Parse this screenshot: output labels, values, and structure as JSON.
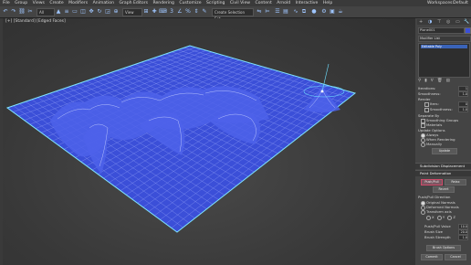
{
  "menu": {
    "items": [
      "File",
      "Group",
      "Views",
      "Create",
      "Modifiers",
      "Animation",
      "Graph Editors",
      "Rendering",
      "Customize",
      "Scripting",
      "Civil View",
      "Content",
      "Arnold",
      "Interactive",
      "Help"
    ],
    "workspaces_label": "Workspaces:",
    "workspace_value": "Default"
  },
  "toolbar": {
    "filter_value": "All",
    "create_selection_placeholder": "Create Selection Set"
  },
  "viewport": {
    "label": "[+] [Standard] [Edged Faces]",
    "mesh_color": "#3b4fd8",
    "wire_color": "#a9b6ff",
    "border_color": "#7fe6ff"
  },
  "panel": {
    "object_name": "Plane001",
    "modifier_list_label": "Modifier List",
    "stack_item": "Editable Poly",
    "smoothing": {
      "iterations_label": "Iterations:",
      "iterations_value": "1",
      "smoothness_label": "Smoothness:",
      "smoothness_value": "1.0",
      "render_label": "Render",
      "render_iters_label": "Iters:",
      "render_iters_value": "0",
      "smoothness2_label": "Smoothness:",
      "smoothness2_value": "1.0",
      "separate_by_label": "Separate By",
      "smoothing_groups_label": "Smoothing Groups",
      "materials_label": "Materials",
      "update_options_label": "Update Options",
      "always_label": "Always",
      "when_rendering_label": "When Rendering",
      "manually_label": "Manually",
      "update_button": "Update"
    },
    "subdivision_displacement_label": "Subdivision Displacement",
    "paint_deformation_label": "Paint Deformation",
    "push_pull_button": "Push/Pull",
    "relax_button": "Relax",
    "revert_button": "Revert",
    "push_pull_direction_label": "Push/Pull Direction",
    "original_normals_label": "Original Normals",
    "deformed_normals_label": "Deformed Normals",
    "transform_axis_label": "Transform axis",
    "axis_x": "X",
    "axis_y": "Y",
    "axis_z": "Z",
    "push_pull_value_label": "Push/Pull Value",
    "push_pull_value": "10.0",
    "brush_size_label": "Brush Size",
    "brush_size_value": "20.0",
    "brush_strength_label": "Brush Strength",
    "brush_strength_value": "1.0",
    "brush_options_button": "Brush Options",
    "commit_button": "Commit",
    "cancel_button": "Cancel"
  }
}
